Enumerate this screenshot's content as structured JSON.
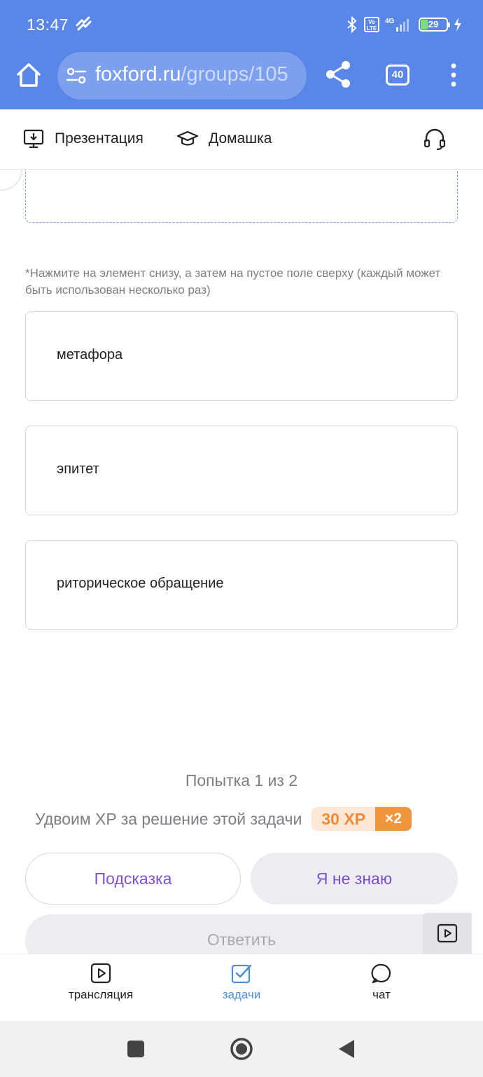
{
  "status_bar": {
    "time": "13:47",
    "network": "4G",
    "volte": "Vo LTE",
    "battery": "29"
  },
  "browser": {
    "url_main": "foxford.ru",
    "url_path": "/groups/105",
    "tabs_count": "40"
  },
  "toolbar": {
    "presentation_label": "Презентация",
    "homework_label": "Домашка"
  },
  "task": {
    "hint_text": "*Нажмите на элемент снизу, а затем на пустое поле сверху (каждый может быть использован несколько раз)",
    "options": [
      {
        "label": "метафора"
      },
      {
        "label": "эпитет"
      },
      {
        "label": "риторическое обращение"
      }
    ],
    "attempt": "Попытка 1 из 2",
    "xp_text": "Удвоим XP за решение этой задачи",
    "xp_value": "30 XP",
    "xp_multiplier": "×2",
    "hint_button": "Подсказка",
    "dont_know_button": "Я не знаю",
    "answer_button": "Ответить"
  },
  "bottom_nav": {
    "items": [
      {
        "label": "трансляция"
      },
      {
        "label": "задачи"
      },
      {
        "label": "чат"
      }
    ]
  },
  "colors": {
    "header_blue": "#5a86e8",
    "accent_purple": "#7b4fd6",
    "xp_orange": "#ef8a3a",
    "active_nav": "#4a8fd8"
  }
}
